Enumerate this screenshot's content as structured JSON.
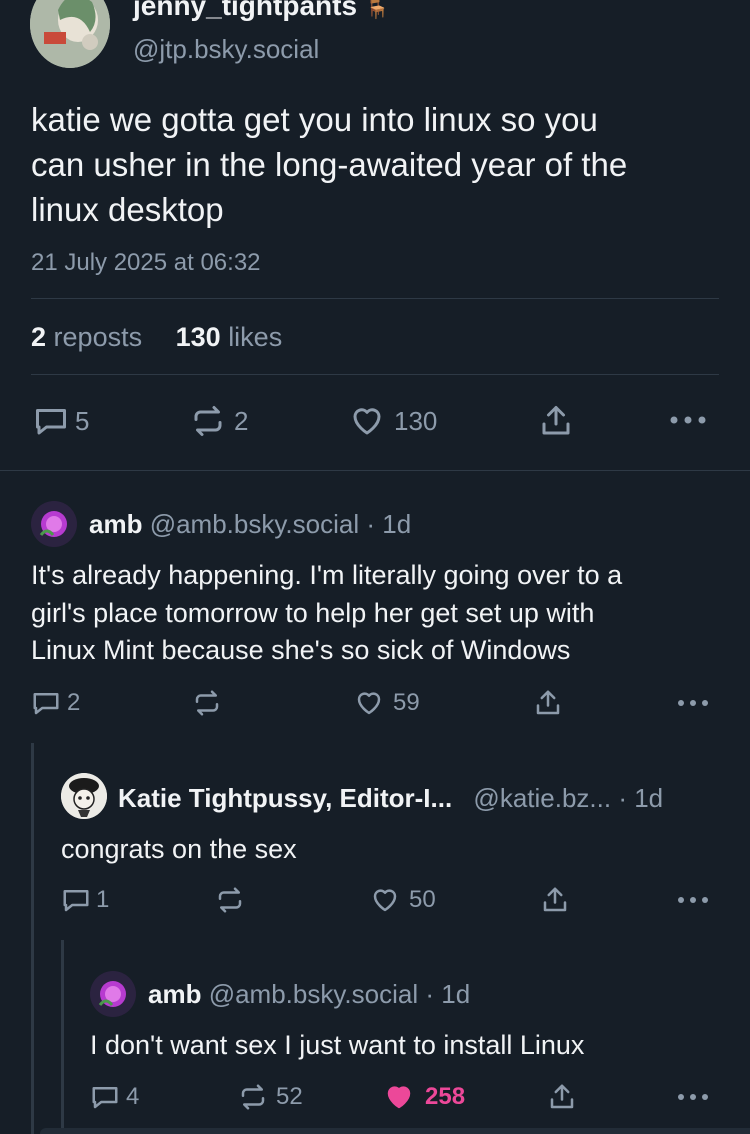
{
  "main_post": {
    "display_name": "jenny_tightpants",
    "emoji": "🪑",
    "handle": "@jtp.bsky.social",
    "text_lines": [
      "katie we gotta get you into linux so you",
      "can usher in the long-awaited year of the",
      "linux desktop"
    ],
    "timestamp": "21 July 2025 at 06:32",
    "stats": {
      "reposts_count": "2",
      "reposts_label": "reposts",
      "likes_count": "130",
      "likes_label": "likes"
    },
    "actions": {
      "replies": "5",
      "reposts": "2",
      "likes": "130"
    }
  },
  "replies": [
    {
      "display_name": "amb",
      "handle": "@amb.bsky.social",
      "age": "· 1d",
      "text_lines": [
        "It's already happening. I'm literally going over to a",
        "girl's place tomorrow to help her get set up with",
        "Linux Mint because she's so sick of Windows"
      ],
      "replies": "2",
      "reposts": "",
      "likes": "59",
      "liked": false
    },
    {
      "display_name": "Katie Tightpussy, Editor-I...",
      "handle": "@katie.bz...",
      "age": "· 1d",
      "text_lines": [
        "congrats on the sex"
      ],
      "replies": "1",
      "reposts": "",
      "likes": "50",
      "liked": false
    },
    {
      "display_name": "amb",
      "handle": "@amb.bsky.social",
      "age": "· 1d",
      "text_lines": [
        "I don't want sex I just want to install Linux"
      ],
      "replies": "4",
      "reposts": "52",
      "likes": "258",
      "liked": true
    }
  ],
  "colors": {
    "background": "#161e27",
    "muted": "#8d9bab",
    "divider": "#2e3945",
    "liked": "#ec4899"
  }
}
